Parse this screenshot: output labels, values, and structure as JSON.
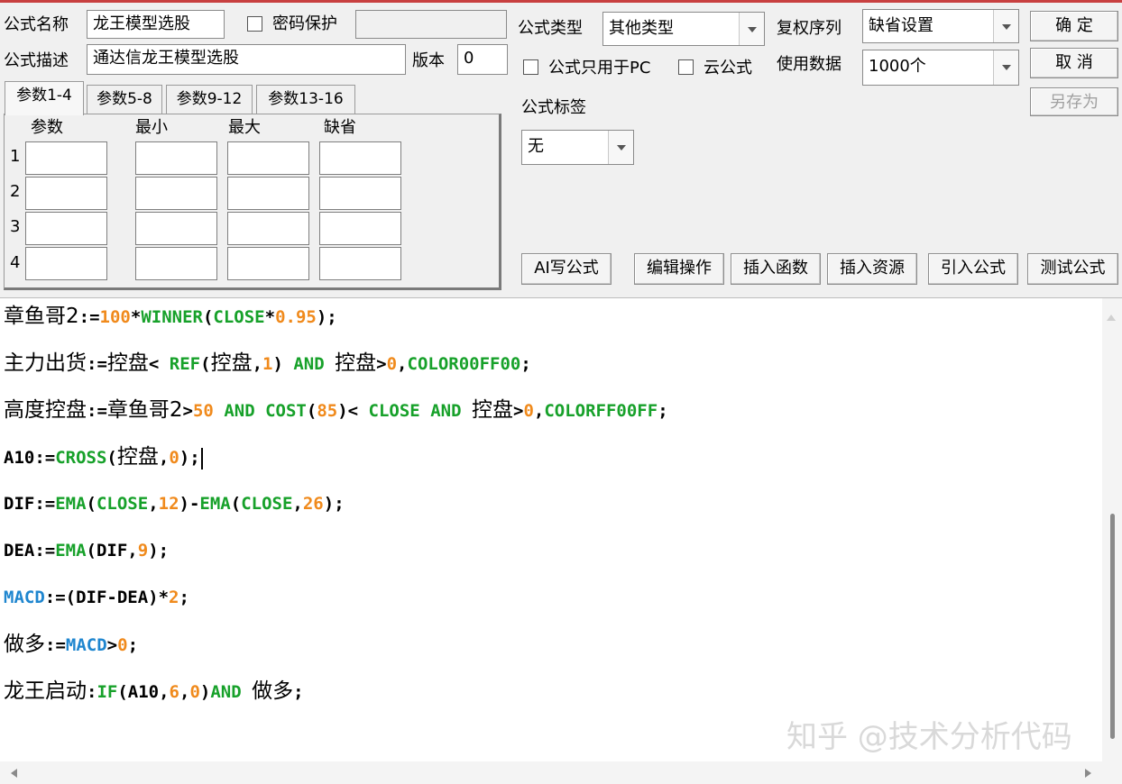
{
  "header": {
    "name_label": "公式名称",
    "name_value": "龙王模型选股",
    "password_label": "密码保护",
    "desc_label": "公式描述",
    "desc_value": "通达信龙王模型选股",
    "version_label": "版本",
    "version_value": "0",
    "type_label": "公式类型",
    "type_value": "其他类型",
    "adjust_label": "复权序列",
    "adjust_value": "缺省设置",
    "pc_only_label": "公式只用于PC",
    "cloud_label": "云公式",
    "data_label": "使用数据",
    "data_value": "1000个",
    "tag_label": "公式标签",
    "tag_value": "无"
  },
  "buttons": {
    "ok": "确  定",
    "cancel": "取  消",
    "save_as": "另存为",
    "ai": "AI写公式",
    "edit": "编辑操作",
    "insert_func": "插入函数",
    "insert_res": "插入资源",
    "import": "引入公式",
    "test": "测试公式"
  },
  "tabs": [
    "参数1-4",
    "参数5-8",
    "参数9-12",
    "参数13-16"
  ],
  "params": {
    "columns": [
      "参数",
      "最小",
      "最大",
      "缺省"
    ],
    "rows": [
      "1",
      "2",
      "3",
      "4"
    ]
  },
  "code": [
    [
      [
        "章鱼哥2",
        "cn"
      ],
      [
        ":=",
        ""
      ],
      [
        "100",
        "n"
      ],
      [
        "*",
        ""
      ],
      [
        "WINNER",
        "k"
      ],
      [
        "(",
        ""
      ],
      [
        "CLOSE",
        "k"
      ],
      [
        "*",
        ""
      ],
      [
        "0.95",
        "n"
      ],
      [
        ");",
        ""
      ]
    ],
    [
      [
        "主力出货",
        "cn"
      ],
      [
        ":=",
        ""
      ],
      [
        "控盘",
        "cn"
      ],
      [
        "< ",
        ""
      ],
      [
        "REF",
        "k"
      ],
      [
        "(",
        ""
      ],
      [
        "控盘",
        "cn"
      ],
      [
        ",",
        ""
      ],
      [
        "1",
        "n"
      ],
      [
        ") ",
        ""
      ],
      [
        "AND",
        "k"
      ],
      [
        " ",
        ""
      ],
      [
        "控盘",
        "cn"
      ],
      [
        ">",
        ""
      ],
      [
        "0",
        "n"
      ],
      [
        ",",
        ""
      ],
      [
        "COLOR00FF00",
        "k"
      ],
      [
        ";",
        ""
      ]
    ],
    [
      [
        "高度控盘",
        "cn"
      ],
      [
        ":=",
        ""
      ],
      [
        "章鱼哥2",
        "cn"
      ],
      [
        ">",
        ""
      ],
      [
        "50",
        "n"
      ],
      [
        " ",
        ""
      ],
      [
        "AND",
        "k"
      ],
      [
        " ",
        ""
      ],
      [
        "COST",
        "k"
      ],
      [
        "(",
        ""
      ],
      [
        "85",
        "n"
      ],
      [
        ")< ",
        ""
      ],
      [
        "CLOSE",
        "k"
      ],
      [
        " ",
        ""
      ],
      [
        "AND",
        "k"
      ],
      [
        " ",
        ""
      ],
      [
        "控盘",
        "cn"
      ],
      [
        ">",
        ""
      ],
      [
        "0",
        "n"
      ],
      [
        ",",
        ""
      ],
      [
        "COLORFF00FF",
        "k"
      ],
      [
        ";",
        ""
      ]
    ],
    [
      [
        "A10:=",
        ""
      ],
      [
        "CROSS",
        "k"
      ],
      [
        "(",
        ""
      ],
      [
        "控盘",
        "cn"
      ],
      [
        ",",
        ""
      ],
      [
        "0",
        "n"
      ],
      [
        ");",
        ""
      ],
      [
        "",
        "caret"
      ]
    ],
    [
      [
        "DIF:=",
        ""
      ],
      [
        "EMA",
        "k"
      ],
      [
        "(",
        ""
      ],
      [
        "CLOSE",
        "k"
      ],
      [
        ",",
        ""
      ],
      [
        "12",
        "n"
      ],
      [
        ")-",
        ""
      ],
      [
        "EMA",
        "k"
      ],
      [
        "(",
        ""
      ],
      [
        "CLOSE",
        "k"
      ],
      [
        ",",
        ""
      ],
      [
        "26",
        "n"
      ],
      [
        ");",
        ""
      ]
    ],
    [
      [
        "DEA:=",
        ""
      ],
      [
        "EMA",
        "k"
      ],
      [
        "(DIF,",
        ""
      ],
      [
        "9",
        "n"
      ],
      [
        ");",
        ""
      ]
    ],
    [
      [
        "MACD",
        "b"
      ],
      [
        ":=(DIF-DEA)*",
        ""
      ],
      [
        "2",
        "n"
      ],
      [
        ";",
        ""
      ]
    ],
    [
      [
        "做多",
        "cn"
      ],
      [
        ":=",
        ""
      ],
      [
        "MACD",
        "b"
      ],
      [
        ">",
        ""
      ],
      [
        "0",
        "n"
      ],
      [
        ";",
        ""
      ]
    ],
    [
      [
        "龙王启动",
        "cn"
      ],
      [
        ":",
        ""
      ],
      [
        "IF",
        "k"
      ],
      [
        "(A10,",
        ""
      ],
      [
        "6",
        "n"
      ],
      [
        ",",
        ""
      ],
      [
        "0",
        "n"
      ],
      [
        ")",
        ""
      ],
      [
        "AND",
        "k"
      ],
      [
        " ",
        ""
      ],
      [
        "做多",
        "cn"
      ],
      [
        ";",
        ""
      ]
    ]
  ],
  "watermark": "知乎 @技术分析代码"
}
